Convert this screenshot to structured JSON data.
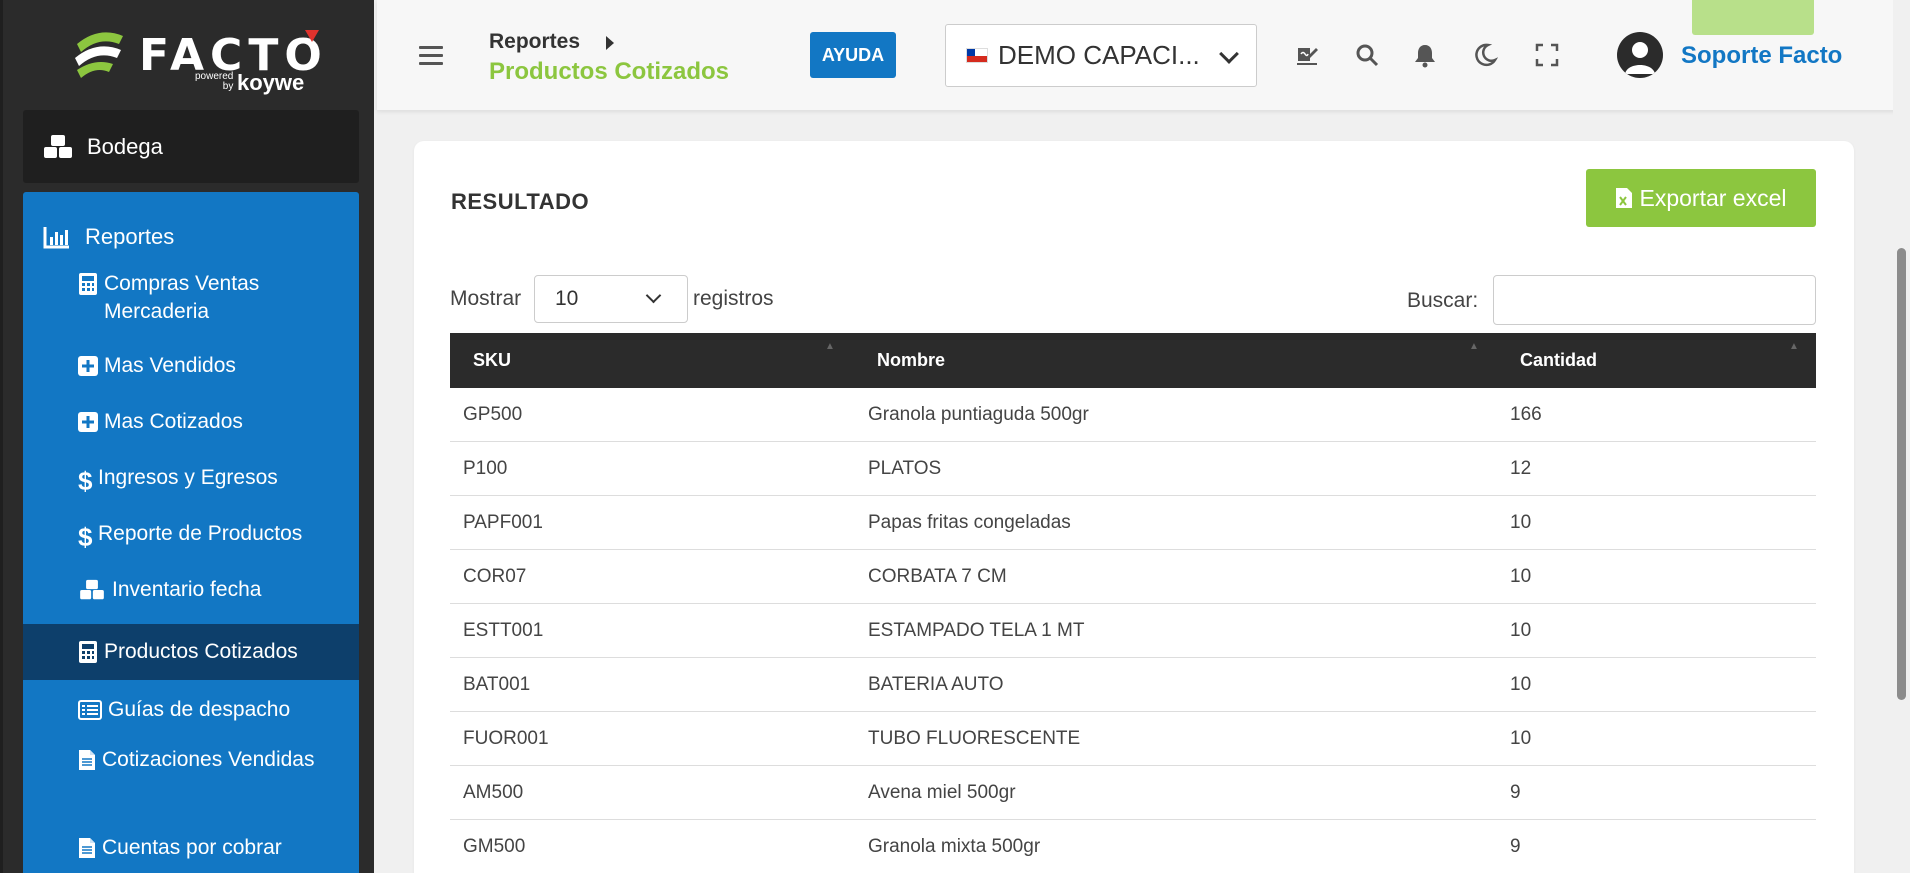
{
  "brand": {
    "name": "FACTO",
    "powered": "powered",
    "by": "by",
    "partner": "koywe",
    "accent": "#8cc63f",
    "primary": "#1277c4"
  },
  "sidebar": {
    "warehouse": {
      "label": "Bodega",
      "icon": "cubes-icon"
    },
    "section": {
      "label": "Reportes",
      "icon": "bar-chart-icon"
    },
    "items": [
      {
        "label": "Compras Ventas Mercaderia",
        "icon": "calculator-icon",
        "active": false
      },
      {
        "label": "Mas Vendidos",
        "icon": "plus-square-icon",
        "active": false
      },
      {
        "label": "Mas Cotizados",
        "icon": "plus-square-icon",
        "active": false
      },
      {
        "label": "Ingresos y Egresos",
        "icon": "dollar-icon",
        "active": false
      },
      {
        "label": "Reporte de Productos",
        "icon": "dollar-icon",
        "active": false
      },
      {
        "label": "Inventario fecha",
        "icon": "cubes-icon",
        "active": false
      },
      {
        "label": "Productos Cotizados",
        "icon": "calculator-icon",
        "active": true
      },
      {
        "label": "Guías de despacho",
        "icon": "list-icon",
        "active": false
      },
      {
        "label": "Cotizaciones Vendidas",
        "icon": "file-icon",
        "active": false
      },
      {
        "label": "Cuentas por cobrar",
        "icon": "file-icon",
        "active": false
      }
    ]
  },
  "header": {
    "breadcrumb_parent": "Reportes",
    "page_title": "Productos Cotizados",
    "help_label": "AYUDA",
    "company": "DEMO CAPACI...",
    "user": "Soporte Facto"
  },
  "content": {
    "card_title": "RESULTADO",
    "export_label": "Exportar excel",
    "show_label": "Mostrar",
    "page_size": "10",
    "records_label": "registros",
    "search_label": "Buscar:",
    "search_value": ""
  },
  "table": {
    "columns": [
      "SKU",
      "Nombre",
      "Cantidad"
    ],
    "rows": [
      [
        "GP500",
        "Granola puntiaguda 500gr",
        "166"
      ],
      [
        "P100",
        "PLATOS",
        "12"
      ],
      [
        "PAPF001",
        "Papas fritas congeladas",
        "10"
      ],
      [
        "COR07",
        "CORBATA 7 CM",
        "10"
      ],
      [
        "ESTT001",
        "ESTAMPADO TELA 1 MT",
        "10"
      ],
      [
        "BAT001",
        "BATERIA AUTO",
        "10"
      ],
      [
        "FUOR001",
        "TUBO FLUORESCENTE",
        "10"
      ],
      [
        "AM500",
        "Avena miel 500gr",
        "9"
      ],
      [
        "GM500",
        "Granola mixta 500gr",
        "9"
      ]
    ]
  }
}
